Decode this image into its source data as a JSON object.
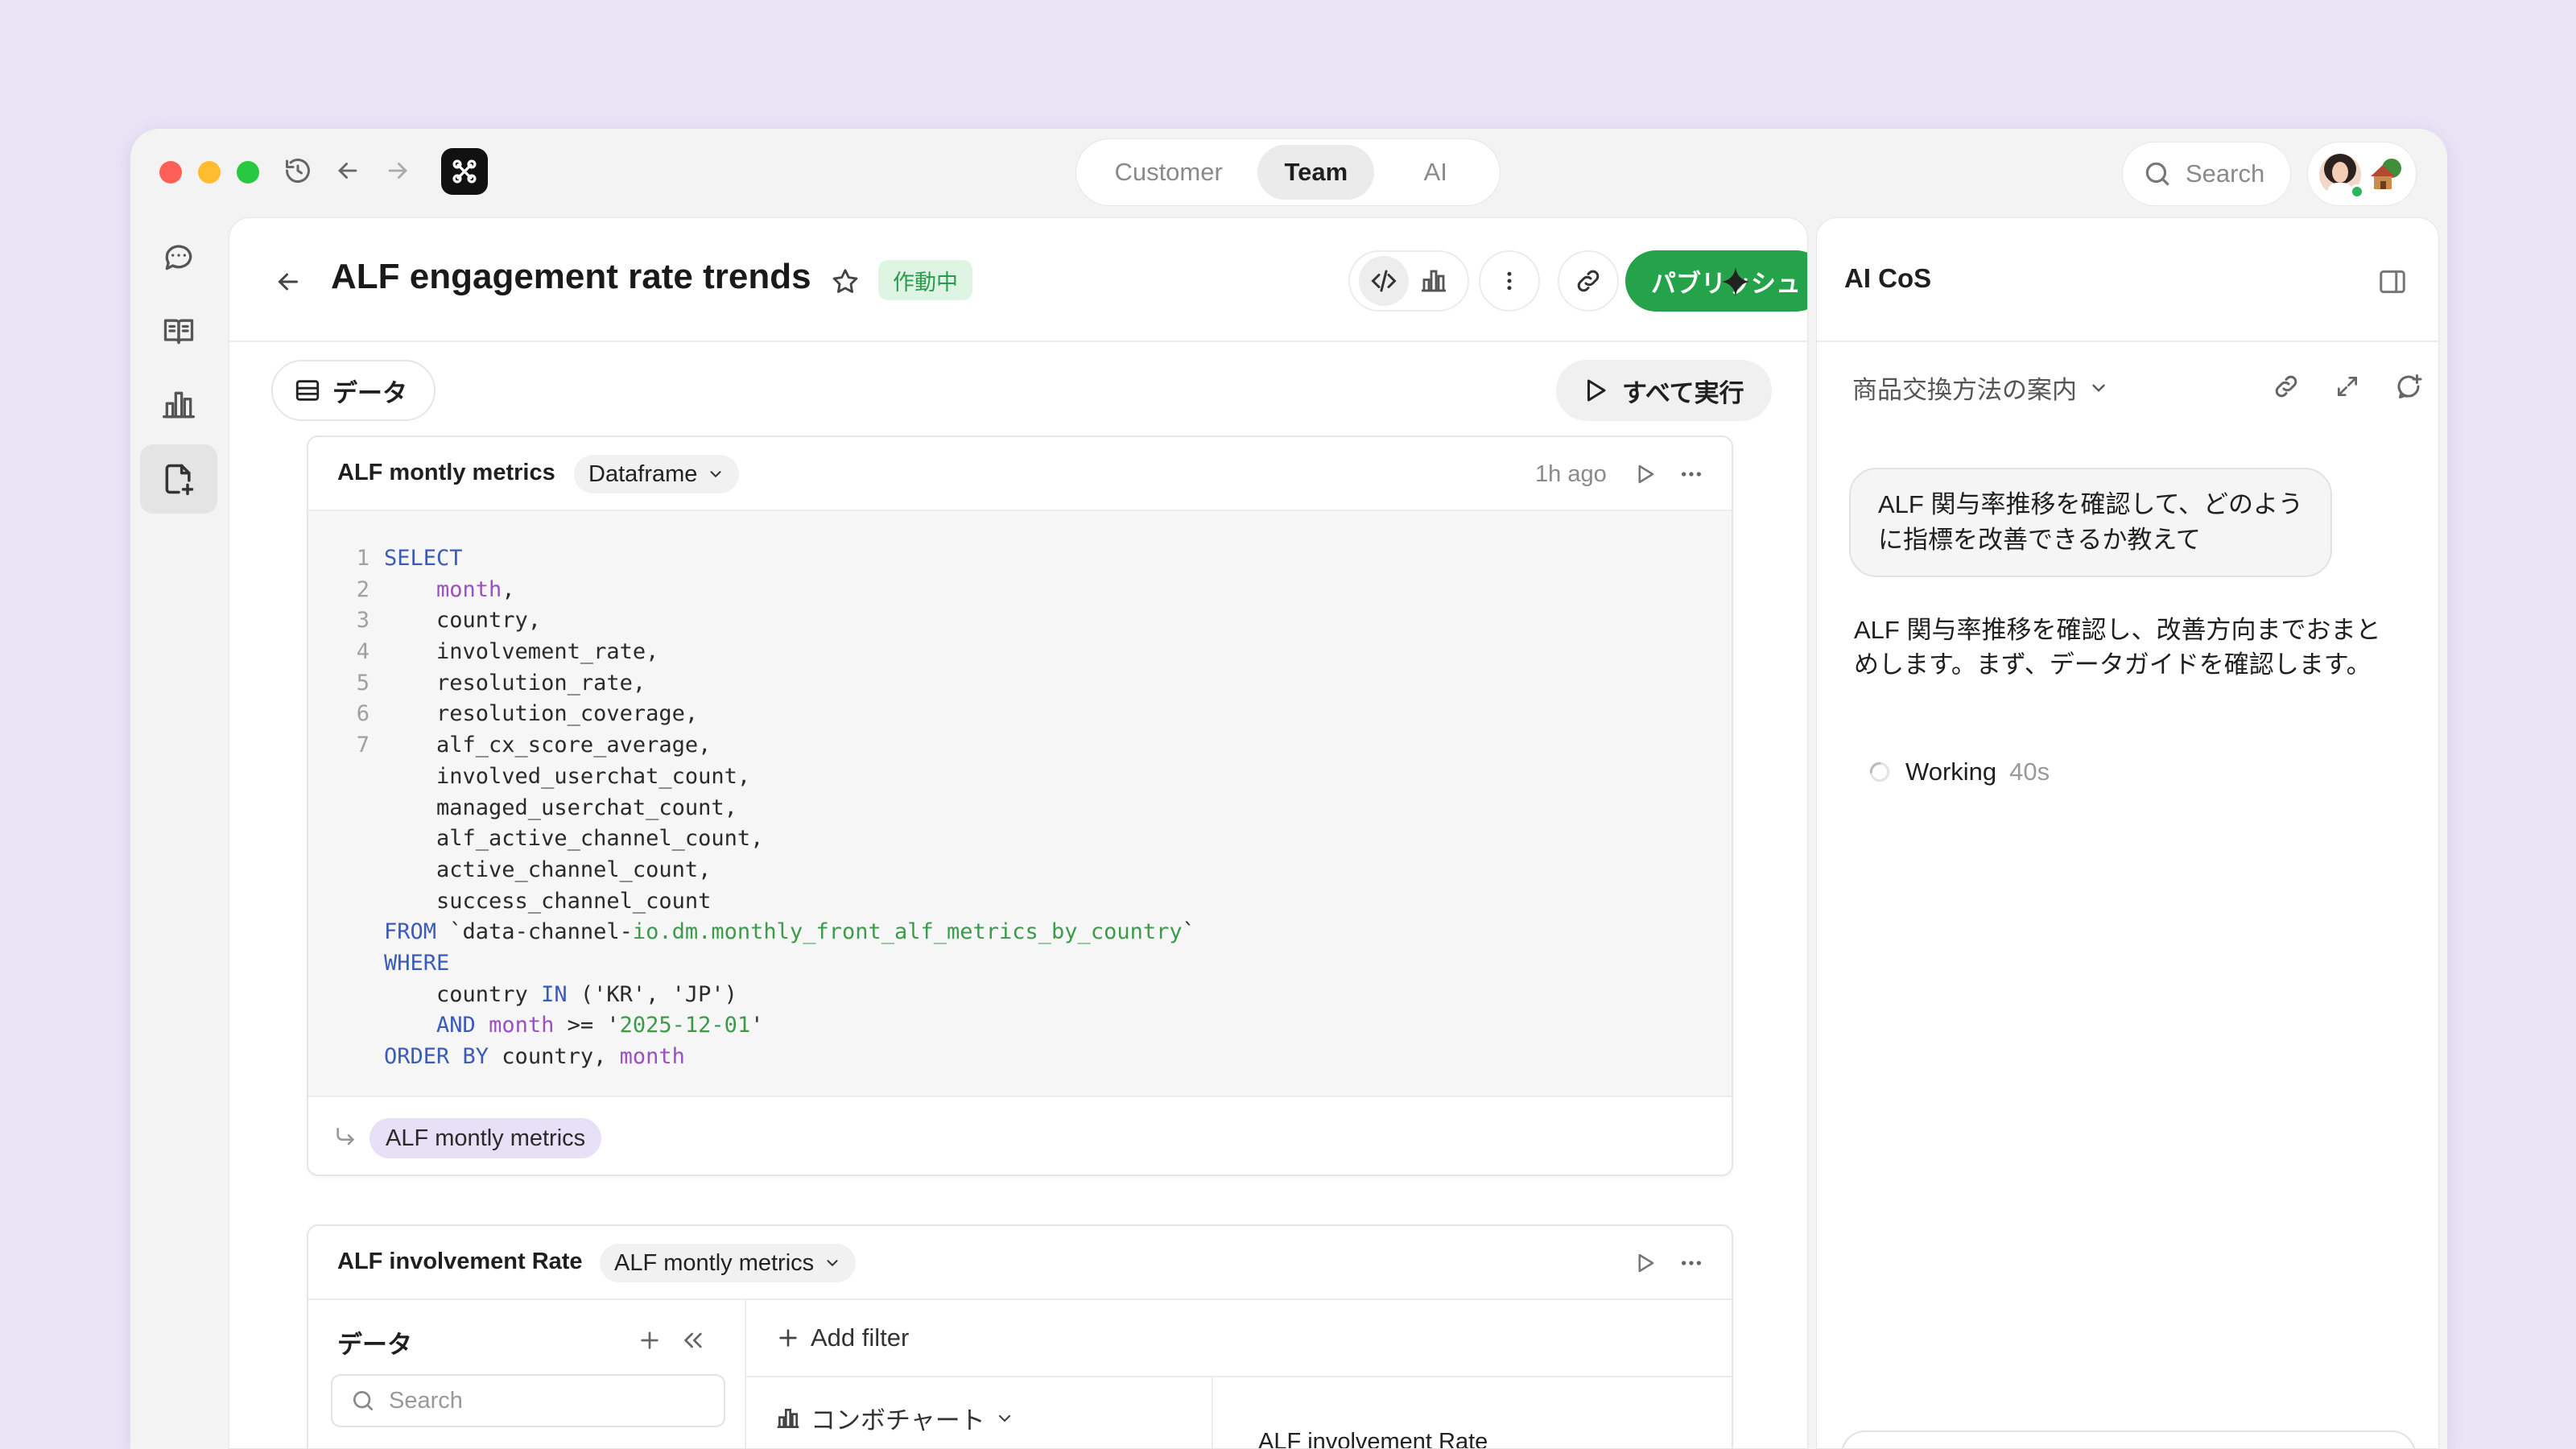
{
  "window": {
    "nav_tabs": [
      {
        "label": "Customer",
        "active": false
      },
      {
        "label": "Team",
        "active": true
      },
      {
        "label": "AI",
        "active": false
      }
    ],
    "search_label": "Search"
  },
  "sidebar": {
    "items": [
      {
        "icon": "chat-icon",
        "active": false
      },
      {
        "icon": "book-icon",
        "active": false
      },
      {
        "icon": "chart-icon",
        "active": false
      },
      {
        "icon": "new-document-icon",
        "active": true
      }
    ]
  },
  "page": {
    "title": "ALF engagement rate trends",
    "status": "作動中",
    "publish_label": "パブリッシュ",
    "data_label": "データ",
    "run_all_label": "すべて実行"
  },
  "cell1": {
    "title": "ALF montly metrics",
    "type": "Dataframe",
    "time": "1h ago",
    "output_label": "ALF montly metrics",
    "code_lines": [
      {
        "ln": "1",
        "parts": [
          [
            "kw",
            "SELECT"
          ]
        ]
      },
      {
        "ln": "2",
        "parts": [
          [
            "",
            "    "
          ],
          [
            "id",
            "month"
          ],
          [
            "",
            ","
          ]
        ]
      },
      {
        "ln": "3",
        "parts": [
          [
            "",
            "    country,"
          ]
        ]
      },
      {
        "ln": "4",
        "parts": [
          [
            "",
            "    involvement_rate,"
          ]
        ]
      },
      {
        "ln": "5",
        "parts": [
          [
            "",
            "    resolution_rate,"
          ]
        ]
      },
      {
        "ln": "6",
        "parts": [
          [
            "",
            "    resolution_coverage,"
          ]
        ]
      },
      {
        "ln": "7",
        "parts": [
          [
            "",
            "    alf_cx_score_average,"
          ]
        ]
      },
      {
        "ln": "",
        "parts": [
          [
            "",
            "    involved_userchat_count,"
          ]
        ]
      },
      {
        "ln": "",
        "parts": [
          [
            "",
            "    managed_userchat_count,"
          ]
        ]
      },
      {
        "ln": "",
        "parts": [
          [
            "",
            "    alf_active_channel_count,"
          ]
        ]
      },
      {
        "ln": "",
        "parts": [
          [
            "",
            "    active_channel_count,"
          ]
        ]
      },
      {
        "ln": "",
        "parts": [
          [
            "",
            "    success_channel_count"
          ]
        ]
      },
      {
        "ln": "",
        "parts": [
          [
            "kw",
            "FROM"
          ],
          [
            "",
            " `data-channel-"
          ],
          [
            "str",
            "io.dm.monthly_front_alf_metrics_by_country"
          ],
          [
            "",
            "`"
          ]
        ]
      },
      {
        "ln": "",
        "parts": [
          [
            "kw",
            "WHERE"
          ]
        ]
      },
      {
        "ln": "",
        "parts": [
          [
            "",
            "    country "
          ],
          [
            "kw",
            "IN"
          ],
          [
            "",
            " ('KR', 'JP')"
          ]
        ]
      },
      {
        "ln": "",
        "parts": [
          [
            "",
            "    "
          ],
          [
            "kw",
            "AND"
          ],
          [
            "",
            " "
          ],
          [
            "id",
            "month"
          ],
          [
            "",
            " >= '"
          ],
          [
            "str",
            "2025-12-01"
          ],
          [
            "",
            "'"
          ]
        ]
      },
      {
        "ln": "",
        "parts": [
          [
            "kw",
            "ORDER BY"
          ],
          [
            "",
            " country, "
          ],
          [
            "id",
            "month"
          ]
        ]
      }
    ]
  },
  "cell2": {
    "title": "ALF involvement Rate",
    "source": "ALF montly metrics",
    "data_header": "データ",
    "search_placeholder": "Search",
    "add_filter_label": "Add filter",
    "chart_type_label": "コンボチャート",
    "chart_title": "ALF involvement Rate"
  },
  "ai_panel": {
    "title": "AI CoS",
    "thread": "商品交換方法の案内",
    "user_message": "ALF 関与率推移を確認して、どのように指標を改善できるか教えて",
    "ai_message": "ALF 関与率推移を確認し、改善方向までおまとめします。まず、データガイドを確認します。",
    "working_label": "Working",
    "working_time": "40s"
  }
}
